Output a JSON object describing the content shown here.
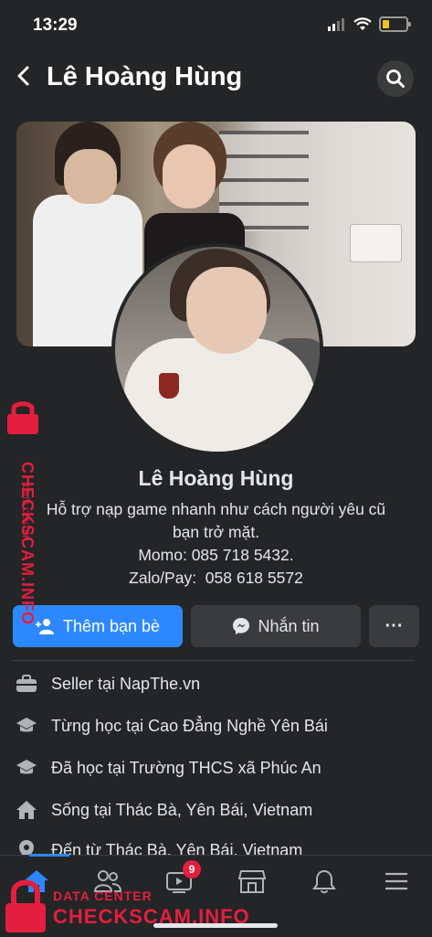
{
  "status": {
    "time": "13:29"
  },
  "header": {
    "title": "Lê Hoàng Hùng"
  },
  "profile": {
    "name": "Lê Hoàng Hùng",
    "bio_lines": [
      "Hỗ trợ nạp game nhanh như cách người yêu cũ",
      "bạn trở mặt.",
      "Momo: 085 718 5432.",
      "Zalo/Pay:  058 618 5572"
    ]
  },
  "actions": {
    "add_friend": "Thêm bạn bè",
    "message": "Nhắn tin",
    "more": "···"
  },
  "details": [
    {
      "icon": "briefcase-icon",
      "prefix": "Seller tại ",
      "value": "NapThe.vn"
    },
    {
      "icon": "graduation-cap-icon",
      "prefix": "Từng học tại ",
      "value": "Cao Đẳng Nghề Yên Bái"
    },
    {
      "icon": "graduation-cap-icon",
      "prefix": "Đã học tại ",
      "value": "Trường THCS xã Phúc An"
    },
    {
      "icon": "home-icon",
      "prefix": "Sống tại ",
      "value": "Thác Bà, Yên Bái, Vietnam"
    },
    {
      "icon": "location-pin-icon",
      "prefix": "Đến từ ",
      "value": "Thác Bà, Yên Bái, Vietnam"
    }
  ],
  "tabbar": {
    "watch_badge": "9"
  },
  "watermark": {
    "side_text": "CHECKSCAM.INFO",
    "side_sub": "DATA CENTER",
    "bottom_top": "DATA CENTER",
    "bottom_main": "CHECKSCAM.INFO"
  },
  "colors": {
    "accent": "#2d88ff",
    "background": "#242526",
    "badge": "#e41e3f"
  }
}
